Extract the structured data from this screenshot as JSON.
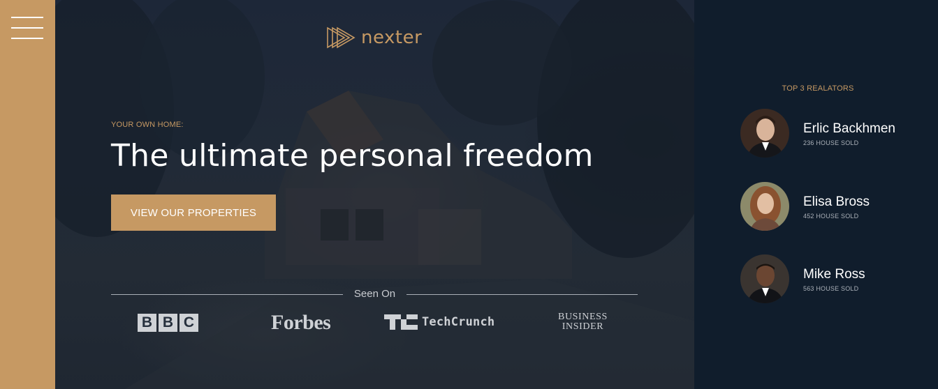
{
  "menu": {
    "icon": "hamburger-menu-icon"
  },
  "brand": {
    "name": "nexter",
    "icon": "nexter-logo-icon",
    "color": "#c69963"
  },
  "hero": {
    "subtitle": "Your own home:",
    "heading": "The ultimate personal freedom",
    "cta_label": "View our properties"
  },
  "seen_on": {
    "label": "Seen On",
    "logos": {
      "bbc": [
        "B",
        "B",
        "C"
      ],
      "forbes": "Forbes",
      "techcrunch": "TechCrunch",
      "business_insider_line1": "BUSINESS",
      "business_insider_line2": "INSIDER"
    }
  },
  "realtors": {
    "title": "Top 3 Realators",
    "items": [
      {
        "name": "Erlic Backhmen",
        "sold": "236 House sold"
      },
      {
        "name": "Elisa Bross",
        "sold": "452 House sold"
      },
      {
        "name": "Mike Ross",
        "sold": "563 House sold"
      }
    ]
  },
  "colors": {
    "accent": "#c69963",
    "dark": "#101d2c",
    "text_light": "#ffffff"
  }
}
